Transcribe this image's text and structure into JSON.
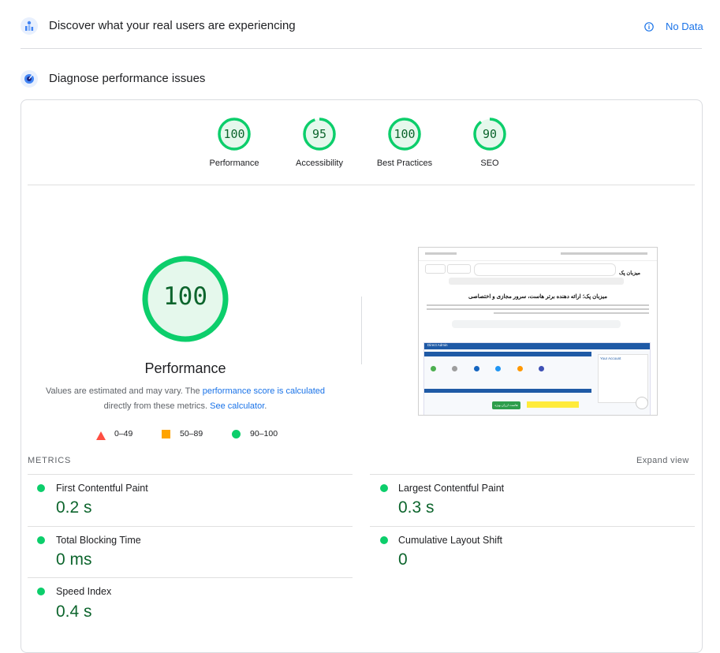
{
  "field": {
    "title": "Discover what your real users are experiencing",
    "info_icon": "info-icon",
    "status": "No Data"
  },
  "lab": {
    "title": "Diagnose performance issues"
  },
  "scores": [
    {
      "label": "Performance",
      "value": "100",
      "fraction": 1.0
    },
    {
      "label": "Accessibility",
      "value": "95",
      "fraction": 0.95
    },
    {
      "label": "Best Practices",
      "value": "100",
      "fraction": 1.0
    },
    {
      "label": "SEO",
      "value": "90",
      "fraction": 0.9
    }
  ],
  "main_gauge": {
    "value": "100",
    "label": "Performance",
    "explain_1": "Values are estimated and may vary. The ",
    "explain_link1": "performance score is calculated",
    "explain_2": "directly from these metrics. ",
    "explain_link2": "See calculator",
    "explain_3": "."
  },
  "legend": [
    {
      "range": "0–49",
      "color": "#ff4e42",
      "shape": "triangle"
    },
    {
      "range": "50–89",
      "color": "#ffa400",
      "shape": "square"
    },
    {
      "range": "90–100",
      "color": "#0cce6b",
      "shape": "circle"
    }
  ],
  "metrics_header": "METRICS",
  "expand_view": "Expand view",
  "metrics": [
    {
      "label": "First Contentful Paint",
      "value": "0.2 s"
    },
    {
      "label": "Largest Contentful Paint",
      "value": "0.3 s"
    },
    {
      "label": "Total Blocking Time",
      "value": "0 ms"
    },
    {
      "label": "Cumulative Layout Shift",
      "value": "0"
    },
    {
      "label": "Speed Index",
      "value": "0.4 s"
    }
  ],
  "screenshot": {
    "brand": "میزبان پک",
    "headline": "میزبان پک؛ ارائه دهنده برتر هاست، سرور مجازی و اختصاصی",
    "panel_title": "Direct Admin",
    "panel_side": "Your Account",
    "cta": "هاست ارزان ویژه"
  },
  "colors": {
    "pass": "#0cce6b",
    "pass_text": "#0d652d",
    "link": "#1a73e8"
  }
}
